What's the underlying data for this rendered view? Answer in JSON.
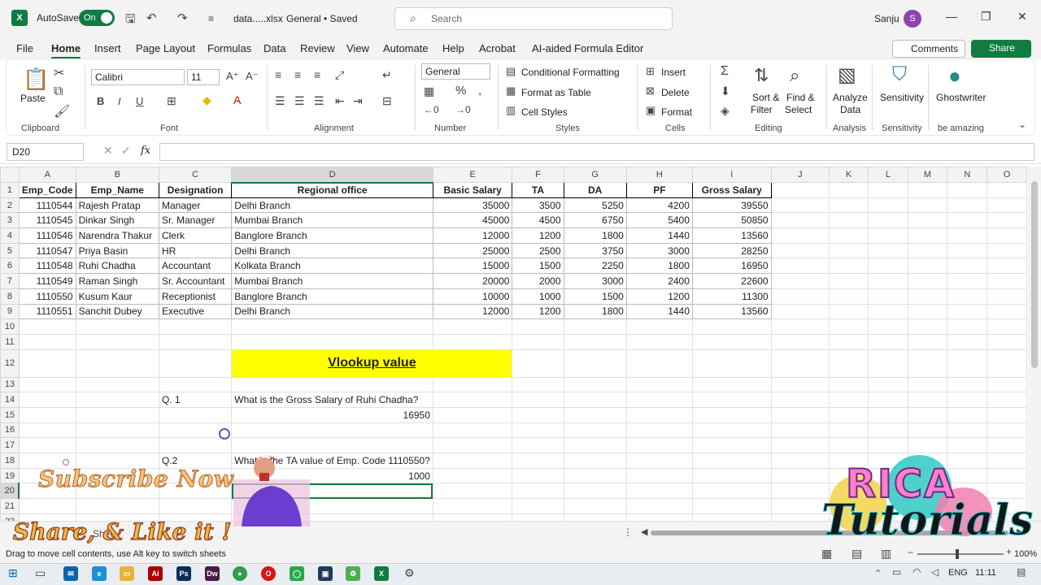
{
  "titlebar": {
    "autosave_label": "AutoSave",
    "autosave_state": "On",
    "filename": "data.....xlsx",
    "save_status": "General • Saved",
    "search_placeholder": "Search",
    "user_name": "Sanju",
    "avatar_initial": "S"
  },
  "menu": {
    "items": [
      "File",
      "Home",
      "Insert",
      "Page Layout",
      "Formulas",
      "Data",
      "Review",
      "View",
      "Automate",
      "Help",
      "Acrobat",
      "AI-aided Formula Editor"
    ],
    "comments": "Comments",
    "share": "Share"
  },
  "ribbon": {
    "paste": "Paste",
    "font_name": "Calibri",
    "font_size": "11",
    "number_format": "General",
    "conditional_formatting": "Conditional Formatting",
    "format_as_table": "Format as Table",
    "cell_styles": "Cell Styles",
    "insert": "Insert",
    "delete": "Delete",
    "format": "Format",
    "sort_filter_1": "Sort &",
    "sort_filter_2": "Filter",
    "find_select_1": "Find &",
    "find_select_2": "Select",
    "analyze_1": "Analyze",
    "analyze_2": "Data",
    "sensitivity": "Sensitivity",
    "ghostwriter": "Ghostwriter",
    "groups": {
      "clipboard": "Clipboard",
      "font": "Font",
      "alignment": "Alignment",
      "number": "Number",
      "styles": "Styles",
      "cells": "Cells",
      "editing": "Editing",
      "analysis": "Analysis",
      "sensitivity": "Sensitivity",
      "be_amazing": "be amazing"
    }
  },
  "formula_bar": {
    "name_box": "D20",
    "fx": "fx",
    "content": ""
  },
  "sheet": {
    "columns": [
      "A",
      "B",
      "C",
      "D",
      "E",
      "F",
      "G",
      "H",
      "I",
      "J",
      "K",
      "L",
      "M",
      "N",
      "O"
    ],
    "headers": [
      "Emp_Code",
      "Emp_Name",
      "Designation",
      "Regional office",
      "Basic Salary",
      "TA",
      "DA",
      "PF",
      "Gross Salary"
    ],
    "rows": [
      [
        "1110544",
        "Rajesh Pratap",
        "Manager",
        "Delhi Branch",
        "35000",
        "3500",
        "5250",
        "4200",
        "39550"
      ],
      [
        "1110545",
        "Dinkar Singh",
        "Sr. Manager",
        "Mumbai Branch",
        "45000",
        "4500",
        "6750",
        "5400",
        "50850"
      ],
      [
        "1110546",
        "Narendra Thakur",
        "Clerk",
        "Banglore Branch",
        "12000",
        "1200",
        "1800",
        "1440",
        "13560"
      ],
      [
        "1110547",
        "Priya Basin",
        "HR",
        "Delhi Branch",
        "25000",
        "2500",
        "3750",
        "3000",
        "28250"
      ],
      [
        "1110548",
        "Ruhi Chadha",
        "Accountant",
        "Kolkata Branch",
        "15000",
        "1500",
        "2250",
        "1800",
        "16950"
      ],
      [
        "1110549",
        "Raman Singh",
        "Sr. Accountant",
        "Mumbai Branch",
        "20000",
        "2000",
        "3000",
        "2400",
        "22600"
      ],
      [
        "1110550",
        "Kusum Kaur",
        "Receptionist",
        "Banglore Branch",
        "10000",
        "1000",
        "1500",
        "1200",
        "11300"
      ],
      [
        "1110551",
        "Sanchit Dubey",
        "Executive",
        "Delhi Branch",
        "12000",
        "1200",
        "1800",
        "1440",
        "13560"
      ]
    ],
    "vlookup_title": "Vlookup value",
    "q1_label": "Q. 1",
    "q1_text": "What is the Gross Salary of Ruhi Chadha?",
    "q1_answer": "16950",
    "q2_label": "Q.2",
    "q2_text": "What is the TA value of Emp. Code 1110550?",
    "q2_answer": "1000"
  },
  "sheet_tab": "Shee",
  "status": {
    "message": "Drag to move cell contents, use Alt key to switch sheets",
    "zoom": "100%"
  },
  "taskbar": {
    "lang": "ENG",
    "time": "11:11"
  },
  "overlay": {
    "subscribe": "Subscribe Now",
    "share_like": "Share, & Like it !",
    "brand_top": "RICA",
    "brand_bottom": "Tutorials"
  }
}
